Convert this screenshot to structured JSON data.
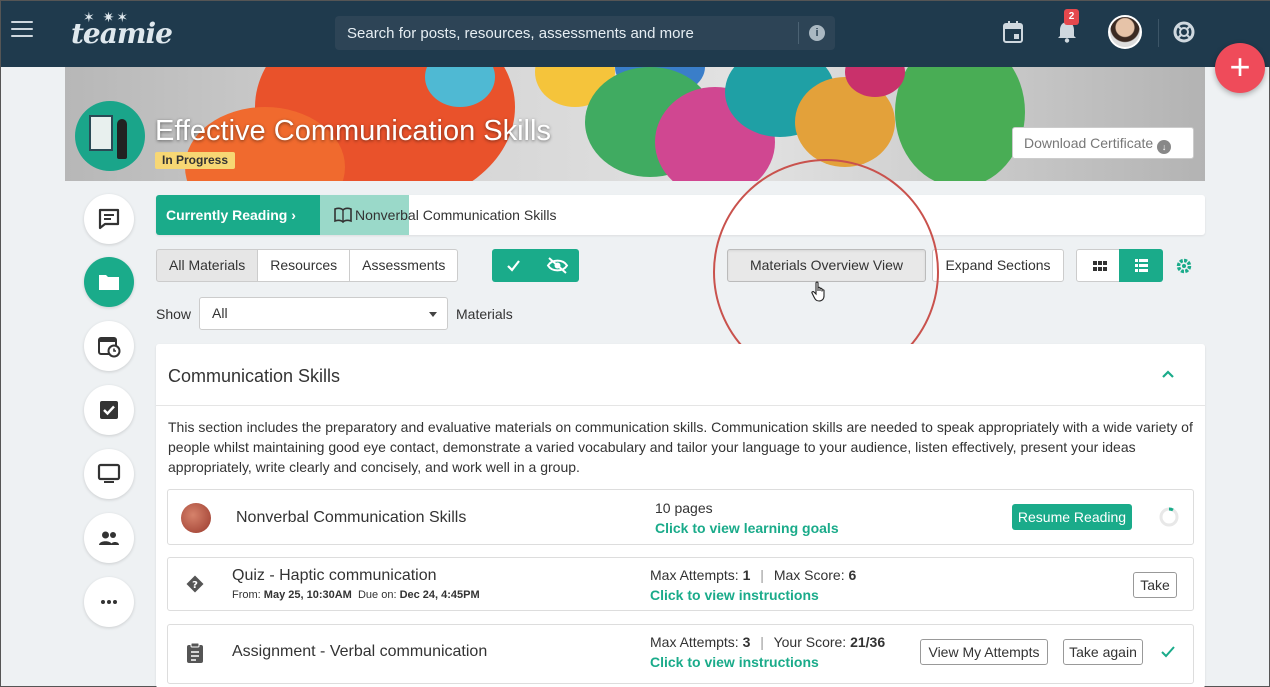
{
  "topbar": {
    "logo": "teamie",
    "search_placeholder": "Search for posts, resources, assessments and more",
    "notification_count": "2"
  },
  "course": {
    "title": "Effective Communication Skills",
    "status": "In Progress",
    "download_certificate": "Download Certificate"
  },
  "reading": {
    "label": "Currently Reading",
    "title": "Nonverbal Communication Skills"
  },
  "filters": {
    "tabs": [
      {
        "label": "All Materials",
        "active": true
      },
      {
        "label": "Resources",
        "active": false
      },
      {
        "label": "Assessments",
        "active": false
      }
    ],
    "overview_view": "Materials Overview View",
    "expand_sections": "Expand Sections",
    "show_label": "Show",
    "show_value": "All",
    "materials_label": "Materials"
  },
  "section": {
    "title": "Communication Skills",
    "description": "This section includes the preparatory and evaluative materials on communication skills. Communication skills are needed to speak appropriately with a wide variety of people whilst maintaining good eye contact, demonstrate a varied vocabulary and tailor your language to your audience, listen effectively, present your ideas appropriately, write clearly and concisely, and work well in a group."
  },
  "items": [
    {
      "title": "Nonverbal Communication Skills",
      "meta": "10 pages",
      "link": "Click to view learning goals",
      "action": "Resume Reading"
    },
    {
      "title": "Quiz - Haptic communication",
      "from_label": "From:",
      "from": "May 25, 10:30AM",
      "due_label": "Due on:",
      "due": "Dec 24, 4:45PM",
      "attempts_label": "Max Attempts:",
      "attempts": "1",
      "score_label": "Max Score:",
      "score": "6",
      "link": "Click to view instructions",
      "action": "Take"
    },
    {
      "title": "Assignment - Verbal communication",
      "attempts_label": "Max Attempts:",
      "attempts": "3",
      "score_label": "Your Score:",
      "score": "21/36",
      "link": "Click to view instructions",
      "view_attempts": "View My Attempts",
      "action": "Take again"
    }
  ],
  "colors": {
    "accent": "#1aab8a",
    "topbar": "#1f3a4d",
    "fab": "#ef4b5a",
    "highlight": "#c9524d",
    "status": "#f7d774"
  },
  "icons": {
    "hamburger": "menu-icon",
    "calendar": "calendar-icon",
    "bell": "bell-icon",
    "help": "lifebuoy-icon",
    "add": "plus-icon"
  }
}
